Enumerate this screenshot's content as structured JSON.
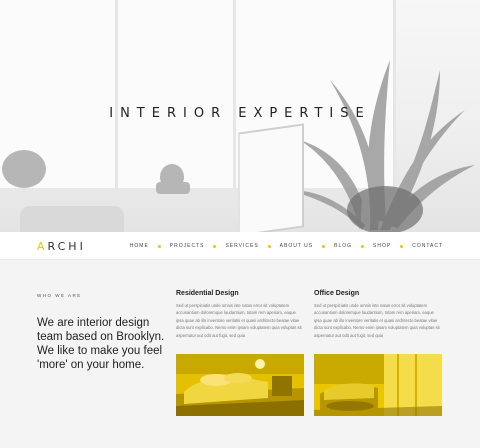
{
  "hero": {
    "title": "INTERIOR EXPERTISE"
  },
  "nav": {
    "logo_mark": "A",
    "logo_rest": "RCHI",
    "items": [
      "HOME",
      "PROJECTS",
      "SERVICES",
      "ABOUT US",
      "BLOG",
      "SHOP",
      "CONTACT"
    ]
  },
  "about": {
    "eyebrow": "WHO WE ARE",
    "lead": "We are interior design team based on Brooklyn. We like to make you feel 'more' on your home."
  },
  "columns": [
    {
      "title": "Residential Design",
      "body": "Sed ut perspiciatis unde omnis iste natus error sit voluptatem accusantium doloremque laudantium, totam rem aperiam, eaque ipsa quae ab illo inventore veritatis et quasi architecto beatae vitae dicta sunt explicabo. Nemo enim ipsam voluptatem quia voluptas sit aspernatur aut odit aut fugit, sed quia"
    },
    {
      "title": "Office Design",
      "body": "Sed ut perspiciatis unde omnis iste natus error sit voluptatem accusantium doloremque laudantium, totam rem aperiam, eaque ipsa quae ab illo inventore veritatis et quasi architecto beatae vitae dicta sunt explicabo. Nemo enim ipsam voluptatem quia voluptas sit aspernatur aut odit aut fugit, sed quia"
    }
  ],
  "colors": {
    "accent": "#f2c300",
    "photo_tint": "#e6c200",
    "background": "#f4f4f4"
  }
}
